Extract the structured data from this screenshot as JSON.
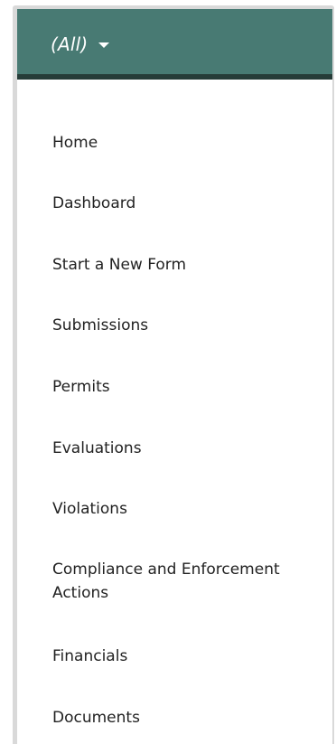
{
  "header": {
    "filter_label": "(All)",
    "filter_icon": "caret-down-icon",
    "bg_color": "#487a73",
    "border_color": "#263c38"
  },
  "nav": {
    "items": [
      {
        "label": "Home"
      },
      {
        "label": "Dashboard"
      },
      {
        "label": "Start a New Form"
      },
      {
        "label": "Submissions"
      },
      {
        "label": "Permits"
      },
      {
        "label": "Evaluations"
      },
      {
        "label": "Violations"
      },
      {
        "label": "Compliance and Enforcement Actions"
      },
      {
        "label": "Financials"
      },
      {
        "label": "Documents"
      }
    ]
  }
}
